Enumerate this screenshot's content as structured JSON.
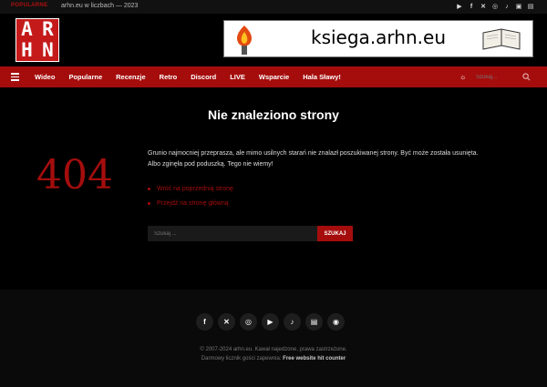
{
  "topbar": {
    "trending_label": "POPULARNE",
    "ticker_text": "arhn.eu w liczbach — 2023",
    "social_icons": [
      "youtube-icon",
      "facebook-icon",
      "x-icon",
      "instagram-icon",
      "tiktok-icon",
      "discord-icon",
      "twitch-icon"
    ]
  },
  "logo": {
    "letters": [
      "A",
      "R",
      "H",
      "N"
    ]
  },
  "banner": {
    "text": "ksiega.arhn.eu"
  },
  "nav": {
    "items": [
      "Wideo",
      "Popularne",
      "Recenzje",
      "Retro",
      "Discord",
      "LIVE",
      "Wsparcie",
      "Hala Sławy!"
    ],
    "search_placeholder": "Szukaj..."
  },
  "main": {
    "title": "Nie znaleziono strony",
    "error_code": "404",
    "message": "Grunio najmocniej przeprasza, ale mimo usilnych starań nie znalazł poszukiwanej strony. Być może została usunięta. Albo zginęła pod poduszką. Tego nie wiemy!",
    "links": [
      "Wróć na poprzednią stronę",
      "Przejdź na stronę główną"
    ],
    "search_placeholder": "Szukaj ...",
    "search_button": "SZUKAJ"
  },
  "footer": {
    "social_icons": [
      "facebook-icon",
      "x-icon",
      "instagram-icon",
      "youtube-icon",
      "tiktok-icon",
      "twitch-icon",
      "rss-icon"
    ],
    "copyright": "© 2007-2024 arhn.eu. Kawał najedzone, prawa zastrzeżone.",
    "counter_text": "Darmowy licznik gości zapewnia:",
    "counter_link": "Free website hit counter"
  },
  "colors": {
    "accent": "#a50d0d",
    "logo_red": "#c51a1a",
    "background": "#000000"
  }
}
